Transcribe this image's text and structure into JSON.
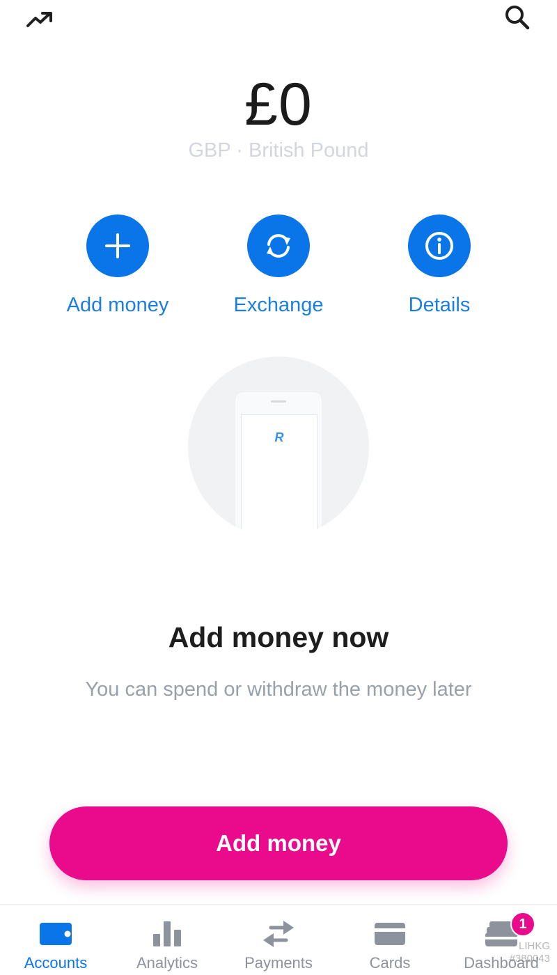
{
  "top_bar": {
    "left_icon": "trending-up-icon",
    "right_icon": "search-icon"
  },
  "balance": {
    "amount": "£0",
    "currency_label": "GBP · British Pound"
  },
  "actions": [
    {
      "label": "Add money",
      "icon": "plus-icon"
    },
    {
      "label": "Exchange",
      "icon": "exchange-icon"
    },
    {
      "label": "Details",
      "icon": "info-icon"
    }
  ],
  "illustration": {
    "logo_text": "R"
  },
  "empty_state": {
    "title": "Add money now",
    "subtitle": "You can spend or withdraw the money later"
  },
  "cta": {
    "label": "Add money"
  },
  "bottom_nav": {
    "items": [
      {
        "label": "Accounts",
        "icon": "wallet-icon",
        "active": true
      },
      {
        "label": "Analytics",
        "icon": "bar-chart-icon",
        "active": false
      },
      {
        "label": "Payments",
        "icon": "transfer-arrows-icon",
        "active": false
      },
      {
        "label": "Cards",
        "icon": "card-icon",
        "active": false
      },
      {
        "label": "Dashboard",
        "icon": "dashboard-cards-icon",
        "active": false
      }
    ],
    "dashboard_badge": "1"
  },
  "watermark": {
    "brand": "LIHKG",
    "user": "#380043"
  },
  "colors": {
    "accent_blue": "#0a75e8",
    "cta_pink": "#ea0a8c",
    "muted_text": "#9aa0a8"
  }
}
